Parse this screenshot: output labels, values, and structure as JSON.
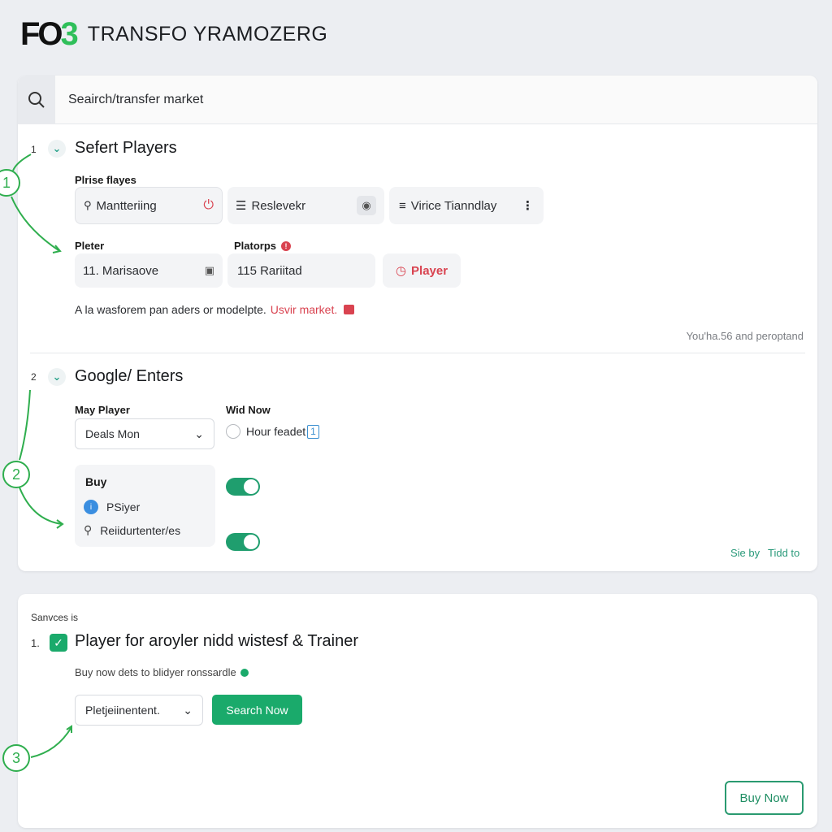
{
  "header": {
    "logo_prefix": "FO",
    "logo_suffix": "3",
    "title": "TRANSFO YRAMOZERG"
  },
  "search": {
    "placeholder": "Seairch/transfer market"
  },
  "section1": {
    "step_number": "1",
    "title": "Sefert Players",
    "filter_label": "Plrise flayes",
    "chips": [
      {
        "label": "Mantteriing",
        "icon": "search-icon",
        "trailing_icon": "power-icon"
      },
      {
        "label": "Reslevekr",
        "icon": "menu-icon",
        "trailing_icon": "globe-icon"
      },
      {
        "label": "Virice Tianndlay",
        "icon": "list-icon",
        "trailing_icon": "more-vertical-icon"
      }
    ],
    "player_label": "Pleter",
    "player_value": "11. Marisaove",
    "platforms_label": "Platorps",
    "platforms_value": "115 Rariitad",
    "player_button": "Player",
    "note_text": "A la wasforem pan aders or modelpte.",
    "note_link": "Usvir market.",
    "footer_note": "You'ha.56 and peroptand"
  },
  "section2": {
    "step_number": "2",
    "title": "Google/ Enters",
    "may_player_label": "May Player",
    "may_player_value": "Deals Mon",
    "wid_now_label": "Wid Now",
    "radio_label": "Hour feadet",
    "radio_badge": "1",
    "buy_title": "Buy",
    "buy_items": [
      {
        "label": "PSiyer",
        "icon": "player-icon"
      },
      {
        "label": "Reiidurtenter/es",
        "icon": "search-user-icon"
      }
    ],
    "toggles": [
      true,
      true
    ],
    "link_sort": "Sie by",
    "link_tidd": "Tidd to"
  },
  "section3": {
    "caption": "Sanvces is",
    "step_number": "1.",
    "title": "Player for aroyler nidd wistesf & Trainer",
    "subtitle": "Buy now dets to blidyer ronssardle",
    "select_value": "Pletjeiinentent.",
    "search_button": "Search Now",
    "buy_button": "Buy Now"
  },
  "annotations": [
    "1",
    "2",
    "3"
  ],
  "colors": {
    "accent_green": "#1aaa6b",
    "danger_red": "#d94350",
    "logo_green": "#2fbf5a"
  }
}
